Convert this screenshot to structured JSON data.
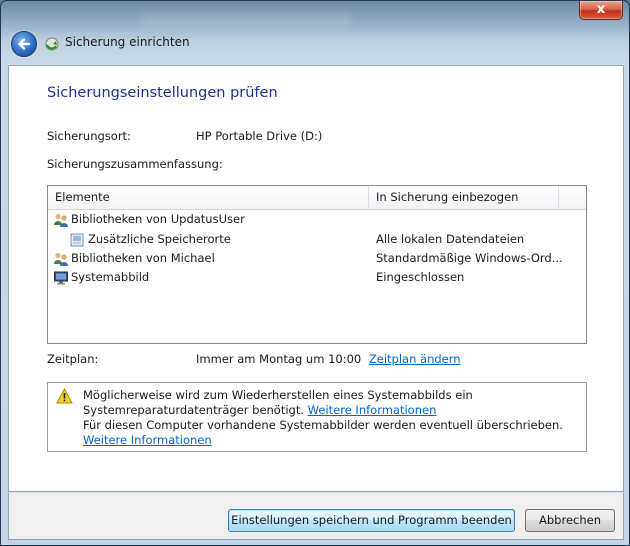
{
  "window": {
    "title": "Sicherung einrichten",
    "close_glyph": "x"
  },
  "page": {
    "heading": "Sicherungseinstellungen prüfen",
    "location_label": "Sicherungsort:",
    "location_value": "HP Portable Drive (D:)",
    "summary_label": "Sicherungszusammenfassung:",
    "schedule_label": "Zeitplan:",
    "schedule_value": "Immer am Montag um 10:00",
    "schedule_link": "Zeitplan ändern"
  },
  "table": {
    "columns": [
      "Elemente",
      "In Sicherung einbezogen"
    ],
    "rows": [
      {
        "icon": "users-library-icon",
        "item": "Bibliotheken von UpdatusUser",
        "included": "",
        "indent": 0
      },
      {
        "icon": "folder-icon",
        "item": "Zusätzliche Speicherorte",
        "included": "Alle lokalen Datendateien",
        "indent": 1
      },
      {
        "icon": "users-library-icon",
        "item": "Bibliotheken von Michael",
        "included": "Standardmäßige Windows-Ord...",
        "indent": 0
      },
      {
        "icon": "monitor-icon",
        "item": "Systemabbild",
        "included": "Eingeschlossen",
        "indent": 0
      }
    ]
  },
  "warning": {
    "icon": "warning-icon",
    "line1": "Möglicherweise wird zum Wiederherstellen eines Systemabbilds ein",
    "line2_text": "Systemreparaturdatenträger benötigt.",
    "line2_link": "Weitere Informationen",
    "line3_text": "Für diesen Computer vorhandene Systemabbilder werden eventuell überschrieben.",
    "line3_link": "Weitere Informationen"
  },
  "buttons": {
    "save_run": "Einstellungen speichern und Programm beenden",
    "cancel": "Abbrechen"
  }
}
